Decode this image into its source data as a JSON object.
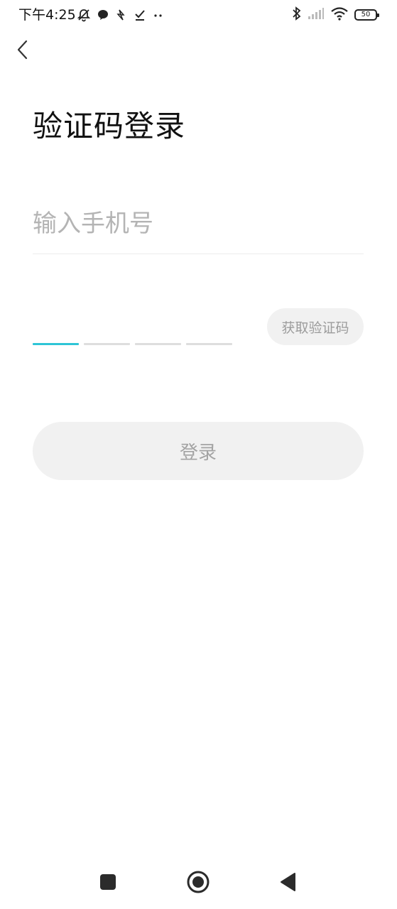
{
  "status_bar": {
    "time": "下午4:25",
    "battery_level": "50",
    "icons": [
      "mute-bell-icon",
      "chat-bubble-icon",
      "notification-icon",
      "download-icon",
      "more-dots-icon",
      "bluetooth-icon",
      "signal-icon",
      "wifi-icon",
      "battery-icon"
    ]
  },
  "header": {
    "back_icon": "chevron-left-icon"
  },
  "main": {
    "title": "验证码登录",
    "phone_placeholder": "输入手机号",
    "phone_value": "",
    "code_digits": [
      "",
      "",
      "",
      ""
    ],
    "get_code_label": "获取验证码",
    "login_label": "登录"
  },
  "nav_bar": {
    "icons": [
      "recents-square-icon",
      "home-circle-icon",
      "back-triangle-icon"
    ]
  },
  "colors": {
    "accent": "#2ec5d6",
    "button_bg": "#f1f1f1",
    "placeholder": "#b4b4b4",
    "button_text": "#9c9c9c"
  }
}
